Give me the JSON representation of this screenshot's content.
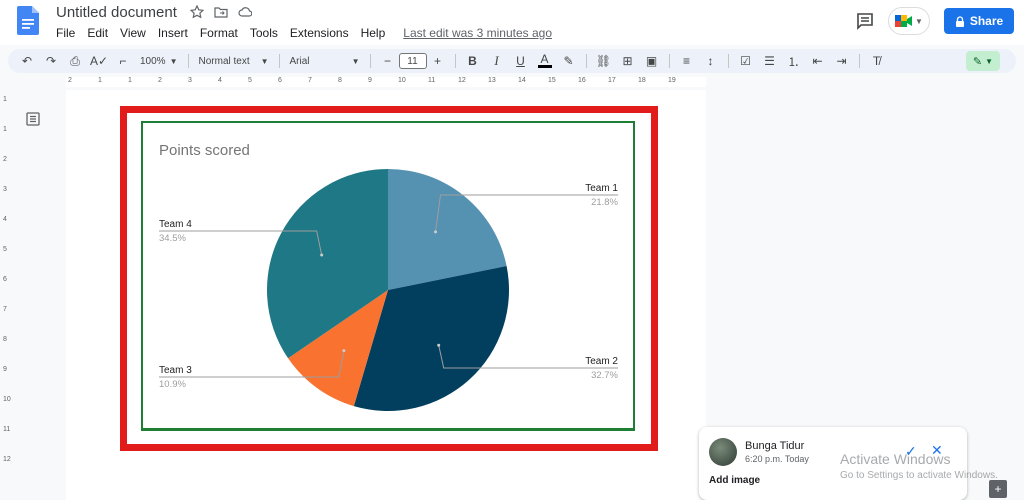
{
  "header": {
    "doc_title": "Untitled document",
    "menu": [
      "File",
      "Edit",
      "View",
      "Insert",
      "Format",
      "Tools",
      "Extensions",
      "Help"
    ],
    "last_edit": "Last edit was 3 minutes ago",
    "share_label": "Share"
  },
  "toolbar": {
    "zoom": "100%",
    "style": "Normal text",
    "font": "Arial",
    "font_size": "11",
    "bold": "B",
    "italic": "I",
    "underline": "U",
    "text_color": "A"
  },
  "ruler": {
    "numbers": [
      "2",
      "1",
      "1",
      "2",
      "3",
      "4",
      "5",
      "6",
      "7",
      "8",
      "9",
      "10",
      "11",
      "12",
      "13",
      "14",
      "15",
      "16",
      "17",
      "18",
      "19"
    ],
    "vertical": [
      "1",
      "1",
      "2",
      "3",
      "4",
      "5",
      "6",
      "7",
      "8",
      "9",
      "10",
      "11",
      "12"
    ]
  },
  "chart_data": {
    "type": "pie",
    "title": "Points scored",
    "slices": [
      {
        "label": "Team 1",
        "value": 21.8,
        "percent_label": "21.8%",
        "color": "#5591b0"
      },
      {
        "label": "Team 2",
        "value": 32.7,
        "percent_label": "32.7%",
        "color": "#023f5f"
      },
      {
        "label": "Team 3",
        "value": 10.9,
        "percent_label": "10.9%",
        "color": "#f9722f"
      },
      {
        "label": "Team 4",
        "value": 34.5,
        "percent_label": "34.5%",
        "color": "#1f7885"
      }
    ]
  },
  "comment": {
    "author": "Bunga Tidur",
    "time": "6:20 p.m. Today",
    "add_image": "Add image"
  },
  "watermark": {
    "line1": "Activate Windows",
    "line2": "Go to Settings to activate Windows."
  },
  "colors": {
    "selection_red": "#e21b1b",
    "chart_border_green": "#1e7e34",
    "share_blue": "#1a73e8"
  }
}
